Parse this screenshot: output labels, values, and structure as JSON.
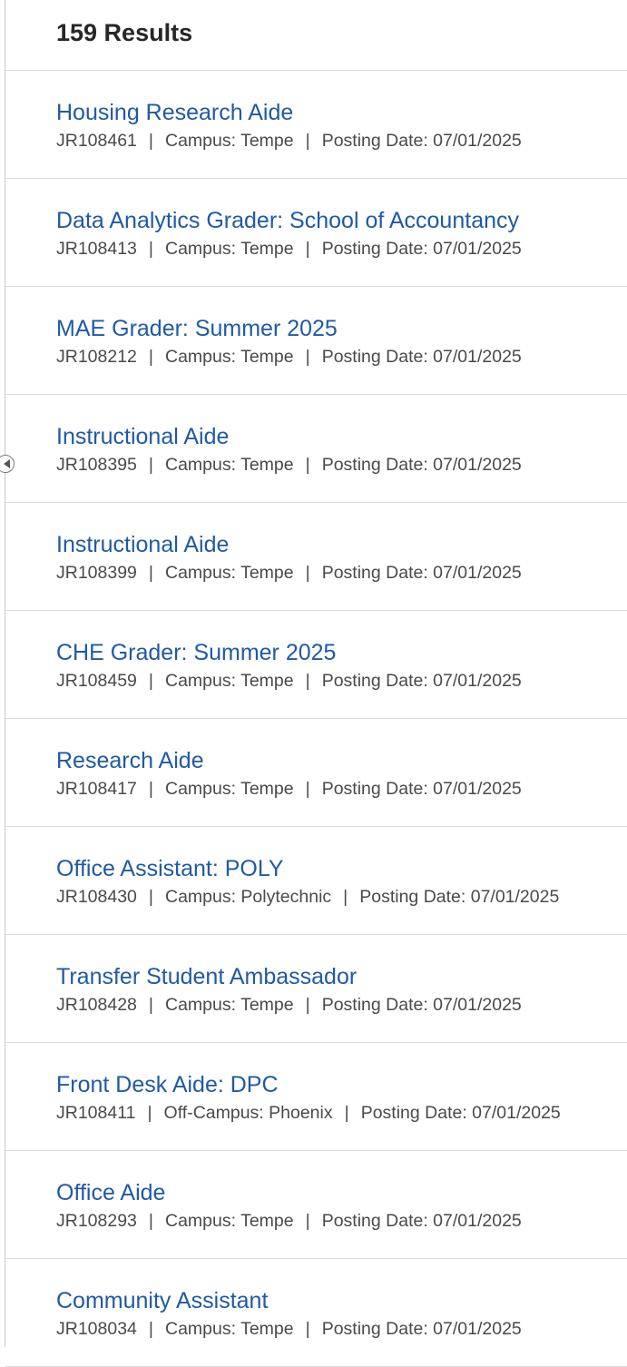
{
  "results": {
    "count_label": "159 Results"
  },
  "separator": "|",
  "jobs": [
    {
      "title": "Housing Research Aide",
      "id": "JR108461",
      "campus": "Campus: Tempe",
      "posting_date": "Posting Date: 07/01/2025"
    },
    {
      "title": "Data Analytics Grader: School of Accountancy",
      "id": "JR108413",
      "campus": "Campus: Tempe",
      "posting_date": "Posting Date: 07/01/2025"
    },
    {
      "title": "MAE Grader: Summer 2025",
      "id": "JR108212",
      "campus": "Campus: Tempe",
      "posting_date": "Posting Date: 07/01/2025"
    },
    {
      "title": "Instructional Aide",
      "id": "JR108395",
      "campus": "Campus: Tempe",
      "posting_date": "Posting Date: 07/01/2025"
    },
    {
      "title": "Instructional Aide",
      "id": "JR108399",
      "campus": "Campus: Tempe",
      "posting_date": "Posting Date: 07/01/2025"
    },
    {
      "title": "CHE Grader: Summer 2025",
      "id": "JR108459",
      "campus": "Campus: Tempe",
      "posting_date": "Posting Date: 07/01/2025"
    },
    {
      "title": "Research Aide",
      "id": "JR108417",
      "campus": "Campus: Tempe",
      "posting_date": "Posting Date: 07/01/2025"
    },
    {
      "title": "Office Assistant: POLY",
      "id": "JR108430",
      "campus": "Campus: Polytechnic",
      "posting_date": "Posting Date: 07/01/2025"
    },
    {
      "title": "Transfer Student Ambassador",
      "id": "JR108428",
      "campus": "Campus: Tempe",
      "posting_date": "Posting Date: 07/01/2025"
    },
    {
      "title": "Front Desk Aide: DPC",
      "id": "JR108411",
      "campus": "Off-Campus: Phoenix",
      "posting_date": "Posting Date: 07/01/2025"
    },
    {
      "title": "Office Aide",
      "id": "JR108293",
      "campus": "Campus: Tempe",
      "posting_date": "Posting Date: 07/01/2025"
    },
    {
      "title": "Community Assistant",
      "id": "JR108034",
      "campus": "Campus: Tempe",
      "posting_date": "Posting Date: 07/01/2025"
    }
  ],
  "icons": {
    "collapse_handle": "chevron-left-circle-icon"
  },
  "colors": {
    "link": "#1f5aa6",
    "meta_text": "#4a4a4a",
    "heading": "#262626",
    "divider": "#dcdcdc"
  }
}
